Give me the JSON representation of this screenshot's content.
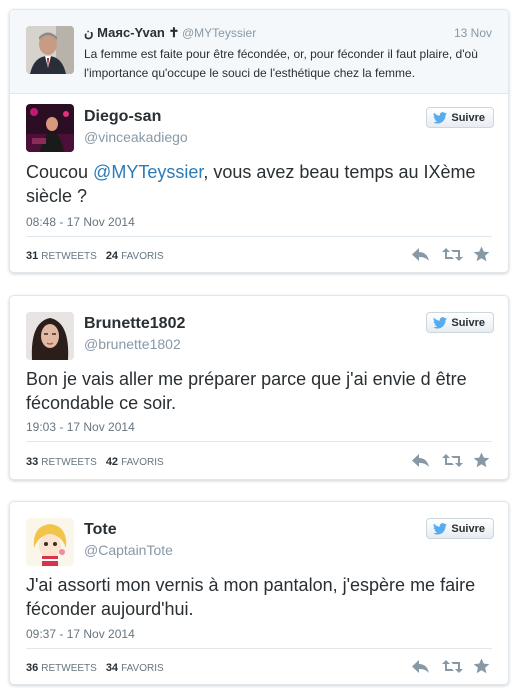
{
  "quoted_tweet": {
    "author_name": "ن Маяс-Yvan ✝",
    "handle": "@MYTeyssier",
    "date": "13 Nov",
    "text": "La femme est faite pour être fécondée, or, pour féconder il faut plaire, d'où l'importance qu'occupe le souci de l'esthétique chez la femme."
  },
  "follow_label": "Suivre",
  "tweets": [
    {
      "name": "Diego-san",
      "handle": "@vinceakadiego",
      "text_before": "Coucou ",
      "mention": "@MYTeyssier",
      "text_after": ", vous avez beau temps au IXème siècle ?",
      "timestamp": "08:48 - 17 Nov 2014",
      "retweets": "31",
      "retweets_label": "RETWEETS",
      "favorites": "24",
      "favorites_label": "FAVORIS"
    },
    {
      "name": "Brunette1802",
      "handle": "@brunette1802",
      "text": "Bon je vais aller me préparer parce que j'ai envie d être fécondable ce soir.",
      "timestamp": "19:03 - 17 Nov 2014",
      "retweets": "33",
      "retweets_label": "RETWEETS",
      "favorites": "42",
      "favorites_label": "FAVORIS"
    },
    {
      "name": "Tote",
      "handle": "@CaptainTote",
      "text": "J'ai assorti mon vernis à mon pantalon, j'espère me faire féconder aujourd'hui.",
      "timestamp": "09:37 - 17 Nov 2014",
      "retweets": "36",
      "retweets_label": "RETWEETS",
      "favorites": "34",
      "favorites_label": "FAVORIS"
    }
  ],
  "colors": {
    "link": "#2b7bb9",
    "muted": "#8899a6",
    "text": "#292f33",
    "twitter_blue": "#55acee"
  },
  "icons": [
    "twitter-bird-icon",
    "reply-icon",
    "retweet-icon",
    "favorite-star-icon"
  ]
}
